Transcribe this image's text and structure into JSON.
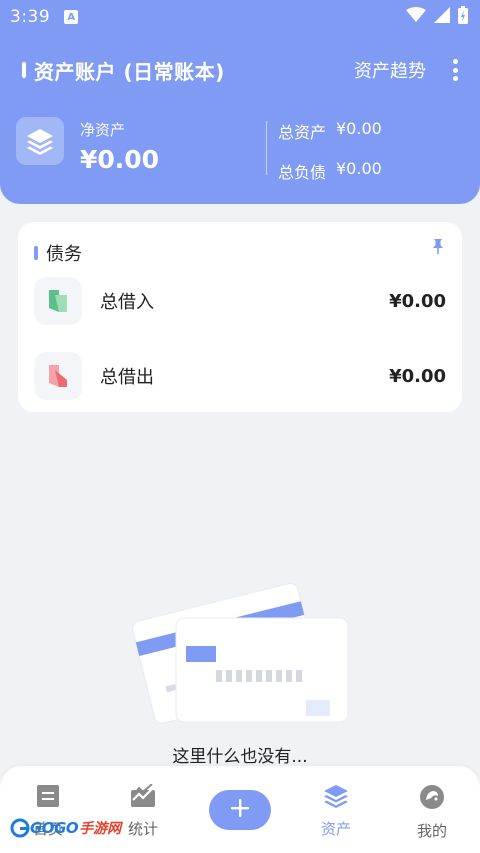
{
  "status_bar": {
    "time": "3:39",
    "notification_badge": "A",
    "icons": [
      "wifi-icon",
      "signal-icon",
      "battery-icon"
    ]
  },
  "header": {
    "title": "资产账户 (日常账本)",
    "trend_link": "资产趋势",
    "menu_icon": "more-vertical-icon"
  },
  "summary": {
    "net_assets_label": "净资产",
    "net_assets_value": "¥0.00",
    "total_assets_label": "总资产",
    "total_assets_value": "¥0.00",
    "total_liabilities_label": "总负债",
    "total_liabilities_value": "¥0.00"
  },
  "debt_card": {
    "title": "债务",
    "pin_icon": "pin-icon",
    "rows": [
      {
        "label": "总借入",
        "amount": "¥0.00",
        "icon": "borrow-in-icon"
      },
      {
        "label": "总借出",
        "amount": "¥0.00",
        "icon": "lend-out-icon"
      }
    ]
  },
  "empty_state": {
    "message": "这里什么也没有..."
  },
  "bottom_nav": {
    "items": [
      {
        "label": "首页",
        "icon": "home-icon",
        "active": false
      },
      {
        "label": "统计",
        "icon": "stats-icon",
        "active": false
      },
      {
        "label": "资产",
        "icon": "assets-layers-icon",
        "active": true
      },
      {
        "label": "我的",
        "icon": "profile-icon",
        "active": false
      }
    ],
    "add_icon": "plus-icon"
  },
  "watermark": {
    "brand": "GOGO",
    "suffix": "手游网"
  },
  "colors": {
    "accent": "#7f9bf3",
    "background": "#f1f2f6",
    "card": "#ffffff",
    "borrow_green": "#5cc08a",
    "lend_red": "#ef6b73"
  }
}
